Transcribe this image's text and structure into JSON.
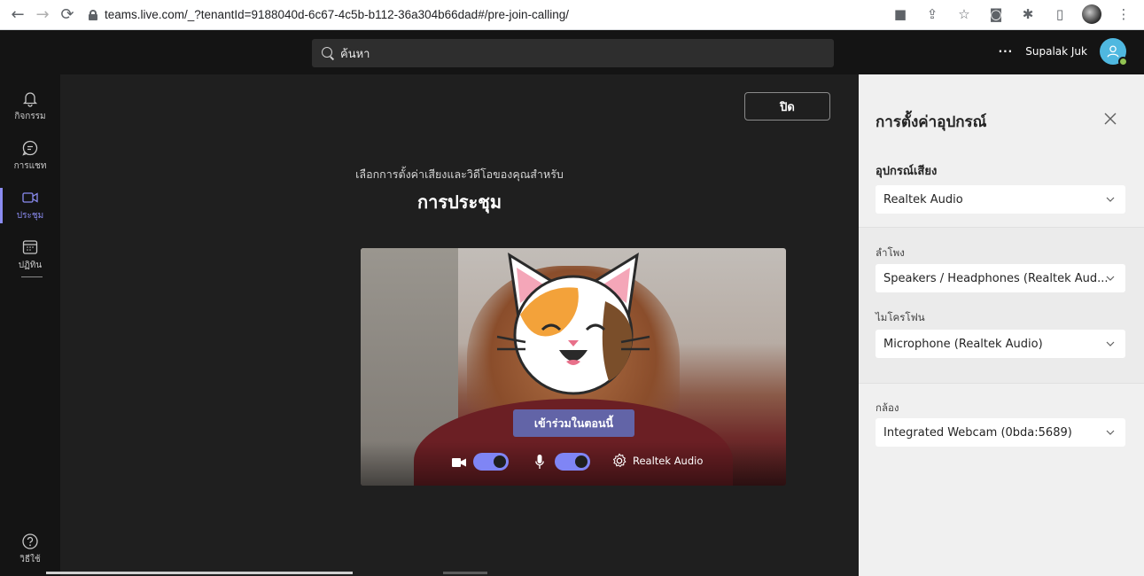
{
  "browser": {
    "url": "teams.live.com/_?tenantId=9188040d-6c67-4c5b-b112-36a304b66dad#/pre-join-calling/"
  },
  "topbar": {
    "search_placeholder": "ค้นหา",
    "more_label": "···",
    "username": "Supalak Juk"
  },
  "rail": {
    "items": [
      {
        "label": "กิจกรรม",
        "icon": "bell-icon"
      },
      {
        "label": "การแชท",
        "icon": "chat-icon"
      },
      {
        "label": "ประชุม",
        "icon": "video-icon",
        "active": true
      },
      {
        "label": "ปฏิทิน",
        "icon": "calendar-icon"
      }
    ],
    "help_label": "วิธีใช้"
  },
  "main": {
    "close_label": "ปิด",
    "subtitle": "เลือกการตั้งค่าเสียงและวิดีโอของคุณสำหรับ",
    "title": "การประชุม",
    "join_label": "เข้าร่วมในตอนนี้",
    "audio_device_label": "Realtek Audio"
  },
  "panel": {
    "title": "การตั้งค่าอุปกรณ์",
    "audio_device": {
      "label": "อุปกรณ์เสียง",
      "value": "Realtek Audio"
    },
    "speaker": {
      "label": "ลำโพง",
      "value": "Speakers / Headphones (Realtek Aud..."
    },
    "microphone": {
      "label": "ไมโครโฟน",
      "value": "Microphone (Realtek Audio)"
    },
    "camera": {
      "label": "กล้อง",
      "value": "Integrated Webcam (0bda:5689)"
    }
  },
  "colors": {
    "accent": "#6264a7",
    "toggle_on": "#7f85f5",
    "presence_available": "#92c353"
  }
}
